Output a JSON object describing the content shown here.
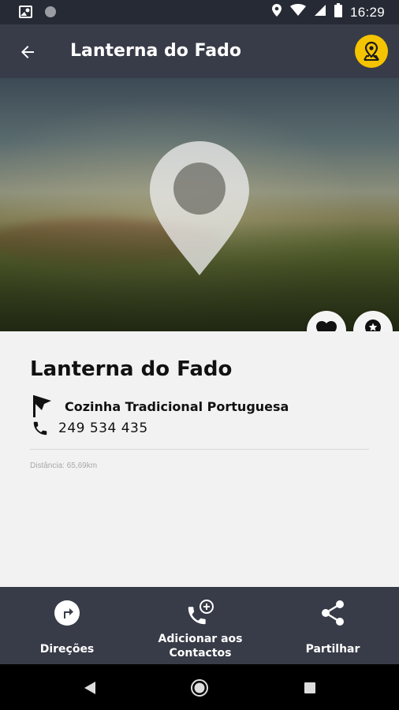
{
  "status_bar": {
    "time": "16:29"
  },
  "app_bar": {
    "title": "Lanterna do Fado"
  },
  "place": {
    "name": "Lanterna do Fado",
    "category": "Cozinha Tradicional Portuguesa",
    "phone": "249 534 435",
    "distance": "Distância: 65,69km"
  },
  "actions": {
    "directions": "Direções",
    "add_contacts_line1": "Adicionar aos",
    "add_contacts_line2": "Contactos",
    "share": "Partilhar"
  },
  "colors": {
    "accent": "#f5c400",
    "bar": "#383c48",
    "status_bar": "#262a35"
  }
}
